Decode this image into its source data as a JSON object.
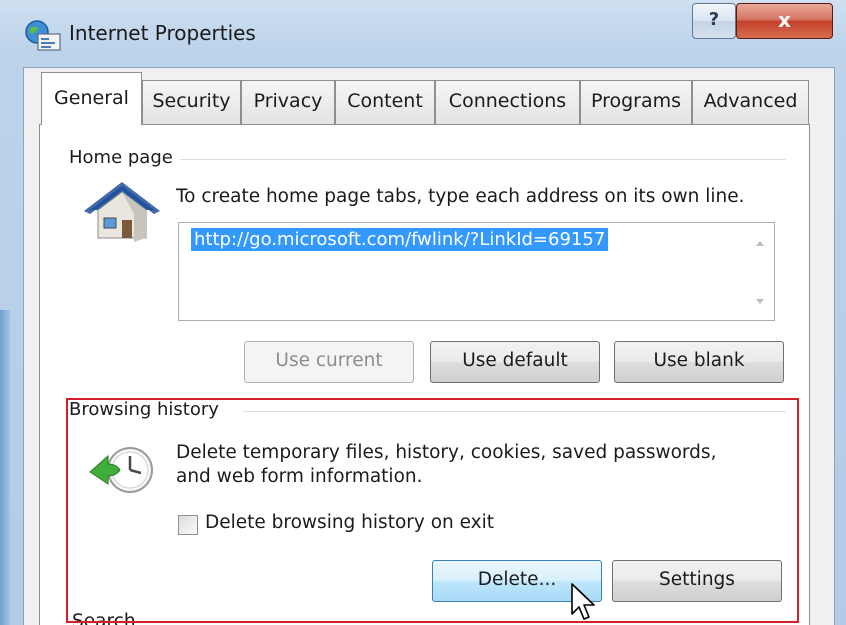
{
  "window": {
    "title": "Internet Properties",
    "help_label": "?",
    "close_label": "x",
    "icons": {
      "app": "internet-options-icon",
      "help": "help-icon",
      "close": "close-icon"
    }
  },
  "tabs": [
    {
      "label": "General",
      "active": true
    },
    {
      "label": "Security",
      "active": false
    },
    {
      "label": "Privacy",
      "active": false
    },
    {
      "label": "Content",
      "active": false
    },
    {
      "label": "Connections",
      "active": false
    },
    {
      "label": "Programs",
      "active": false
    },
    {
      "label": "Advanced",
      "active": false
    }
  ],
  "home_page": {
    "group_label": "Home page",
    "description": "To create home page tabs, type each address on its own line.",
    "url": "http://go.microsoft.com/fwlink/?LinkId=69157",
    "buttons": {
      "use_current": "Use current",
      "use_default": "Use default",
      "use_blank": "Use blank"
    },
    "icon": "house-icon"
  },
  "browsing_history": {
    "group_label": "Browsing history",
    "description_line1": "Delete temporary files, history, cookies, saved passwords,",
    "description_line2": "and web form information.",
    "checkbox_label": "Delete browsing history on exit",
    "checkbox_checked": false,
    "buttons": {
      "delete": "Delete...",
      "settings": "Settings"
    },
    "icon": "history-clock-icon"
  },
  "search": {
    "group_label": "Search"
  },
  "colors": {
    "highlight_box": "#d3202a",
    "selection": "#3399ff",
    "title_bar": "#b8cfe8",
    "close_button": "#c3402a"
  }
}
